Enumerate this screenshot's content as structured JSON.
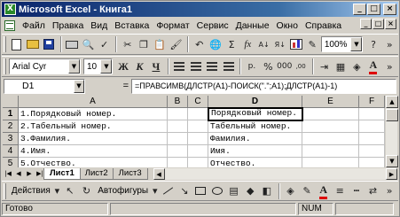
{
  "window": {
    "title": "Microsoft Excel - Книга1"
  },
  "menu": [
    "Файл",
    "Правка",
    "Вид",
    "Вставка",
    "Формат",
    "Сервис",
    "Данные",
    "Окно",
    "Справка"
  ],
  "standard_toolbar": {
    "zoom": "100%"
  },
  "formatting_toolbar": {
    "font_name": "Arial Cyr",
    "font_size": "10",
    "bold": "Ж",
    "italic": "К",
    "underline": "Ч",
    "font_color_letter": "A"
  },
  "formula_bar": {
    "name_box": "D1",
    "equals": "=",
    "formula": "=ПРАВСИМВ(ДЛСТР(A1)-ПОИСК(\".\";A1);ДЛСТР(A1)-1)"
  },
  "sheet": {
    "columns": [
      "A",
      "B",
      "C",
      "D",
      "E",
      "F"
    ],
    "rows": [
      {
        "num": "1",
        "A": "1.Порядковый номер.",
        "D": "Порядковый номер."
      },
      {
        "num": "2",
        "A": "2.Табельный номер.",
        "D": "Табельный номер."
      },
      {
        "num": "3",
        "A": "3.Фамилия.",
        "D": "Фамилия."
      },
      {
        "num": "4",
        "A": "4.Имя.",
        "D": "Имя."
      },
      {
        "num": "5",
        "A": "5.Отчество.",
        "D": "Отчество."
      }
    ],
    "tabs": [
      "Лист1",
      "Лист2",
      "Лист3"
    ]
  },
  "drawing_toolbar": {
    "actions": "Действия",
    "autoshapes": "Автофигуры",
    "font_color_letter": "A"
  },
  "status": {
    "ready": "Готово",
    "num": "NUM"
  }
}
